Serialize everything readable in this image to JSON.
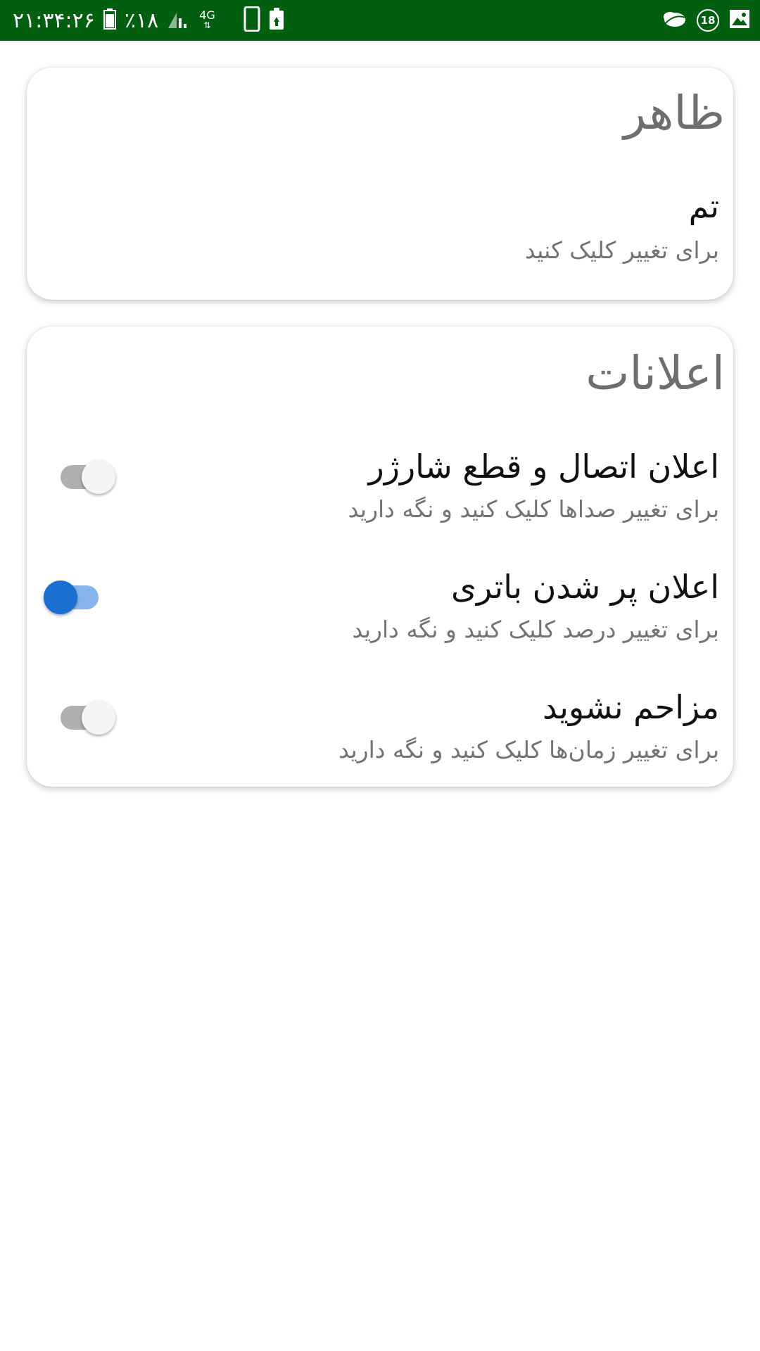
{
  "status_bar": {
    "time": "۲۱:۳۴:۲۶",
    "battery_percent": "٪۱۸",
    "network_type": "4G",
    "notification_badge": "18",
    "background_color": "#015f0f"
  },
  "sections": {
    "appearance": {
      "title": "ظاهر",
      "theme": {
        "title": "تم",
        "summary": "برای تغییر کلیک کنید"
      }
    },
    "notifications": {
      "title": "اعلانات",
      "charger": {
        "title": "اعلان اتصال و قطع شارژر",
        "summary": "برای تغییر صداها کلیک کنید و نگه دارید",
        "enabled": false
      },
      "battery_full": {
        "title": "اعلان پر شدن باتری",
        "summary": "برای تغییر درصد کلیک کنید و نگه دارید",
        "enabled": true
      },
      "dnd": {
        "title": "مزاحم نشوید",
        "summary": "برای تغییر زمان‌ها کلیک کنید و نگه دارید",
        "enabled": false
      }
    }
  },
  "colors": {
    "switch_on": "#1a6fd0",
    "switch_off": "#b0b0b0"
  }
}
